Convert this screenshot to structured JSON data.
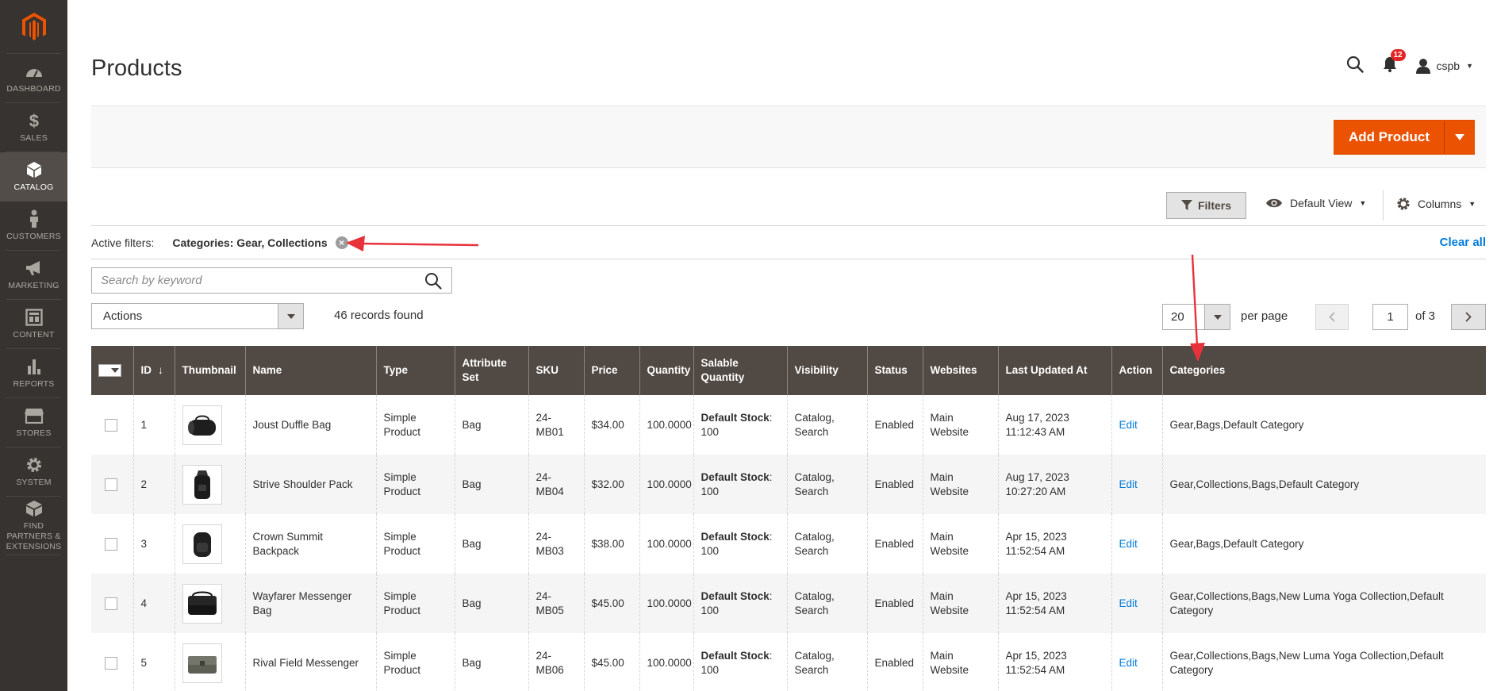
{
  "sidebar": {
    "items": [
      {
        "label": "DASHBOARD",
        "icon": "dashboard-icon"
      },
      {
        "label": "SALES",
        "icon": "dollar-icon"
      },
      {
        "label": "CATALOG",
        "icon": "cube-icon",
        "active": true
      },
      {
        "label": "CUSTOMERS",
        "icon": "person-icon"
      },
      {
        "label": "MARKETING",
        "icon": "megaphone-icon"
      },
      {
        "label": "CONTENT",
        "icon": "layout-icon"
      },
      {
        "label": "REPORTS",
        "icon": "bar-chart-icon"
      },
      {
        "label": "STORES",
        "icon": "store-icon"
      },
      {
        "label": "SYSTEM",
        "icon": "gear-icon"
      },
      {
        "label": "FIND PARTNERS & EXTENSIONS",
        "icon": "partners-icon"
      }
    ]
  },
  "header": {
    "title": "Products",
    "notifications_count": "12",
    "username": "cspb"
  },
  "action_bar": {
    "add_product_label": "Add Product"
  },
  "toolbar": {
    "filters_label": "Filters",
    "view_label": "Default View",
    "columns_label": "Columns"
  },
  "active_filters": {
    "label": "Active filters:",
    "chip": "Categories: Gear, Collections",
    "clear_all": "Clear all"
  },
  "search": {
    "placeholder": "Search by keyword"
  },
  "actions": {
    "label": "Actions",
    "records_found": "46 records found"
  },
  "pagination": {
    "per_page_value": "20",
    "per_page_label": "per page",
    "current_page": "1",
    "of_label": "of 3"
  },
  "table": {
    "columns": [
      "ID",
      "Thumbnail",
      "Name",
      "Type",
      "Attribute Set",
      "SKU",
      "Price",
      "Quantity",
      "Salable Quantity",
      "Visibility",
      "Status",
      "Websites",
      "Last Updated At",
      "Action",
      "Categories"
    ],
    "rows": [
      {
        "id": "1",
        "name": "Joust Duffle Bag",
        "type": "Simple Product",
        "attribute_set": "Bag",
        "sku": "24-MB01",
        "price": "$34.00",
        "quantity": "100.0000",
        "stock_label": "Default Stock",
        "stock_value": "100",
        "visibility": "Catalog, Search",
        "status": "Enabled",
        "websites": "Main Website",
        "updated_date": "Aug 17, 2023",
        "updated_time": "11:12:43 AM",
        "action": "Edit",
        "categories": "Gear,Bags,Default Category",
        "thumb": "duffle"
      },
      {
        "id": "2",
        "name": "Strive Shoulder Pack",
        "type": "Simple Product",
        "attribute_set": "Bag",
        "sku": "24-MB04",
        "price": "$32.00",
        "quantity": "100.0000",
        "stock_label": "Default Stock",
        "stock_value": "100",
        "visibility": "Catalog, Search",
        "status": "Enabled",
        "websites": "Main Website",
        "updated_date": "Aug 17, 2023",
        "updated_time": "10:27:20 AM",
        "action": "Edit",
        "categories": "Gear,Collections,Bags,Default Category",
        "thumb": "shoulder"
      },
      {
        "id": "3",
        "name": "Crown Summit Backpack",
        "type": "Simple Product",
        "attribute_set": "Bag",
        "sku": "24-MB03",
        "price": "$38.00",
        "quantity": "100.0000",
        "stock_label": "Default Stock",
        "stock_value": "100",
        "visibility": "Catalog, Search",
        "status": "Enabled",
        "websites": "Main Website",
        "updated_date": "Apr 15, 2023",
        "updated_time": "11:52:54 AM",
        "action": "Edit",
        "categories": "Gear,Bags,Default Category",
        "thumb": "backpack"
      },
      {
        "id": "4",
        "name": "Wayfarer Messenger Bag",
        "type": "Simple Product",
        "attribute_set": "Bag",
        "sku": "24-MB05",
        "price": "$45.00",
        "quantity": "100.0000",
        "stock_label": "Default Stock",
        "stock_value": "100",
        "visibility": "Catalog, Search",
        "status": "Enabled",
        "websites": "Main Website",
        "updated_date": "Apr 15, 2023",
        "updated_time": "11:52:54 AM",
        "action": "Edit",
        "categories": "Gear,Collections,Bags,New Luma Yoga Collection,Default Category",
        "thumb": "messenger"
      },
      {
        "id": "5",
        "name": "Rival Field Messenger",
        "type": "Simple Product",
        "attribute_set": "Bag",
        "sku": "24-MB06",
        "price": "$45.00",
        "quantity": "100.0000",
        "stock_label": "Default Stock",
        "stock_value": "100",
        "visibility": "Catalog, Search",
        "status": "Enabled",
        "websites": "Main Website",
        "updated_date": "Apr 15, 2023",
        "updated_time": "11:52:54 AM",
        "action": "Edit",
        "categories": "Gear,Collections,Bags,New Luma Yoga Collection,Default Category",
        "thumb": "field"
      }
    ]
  },
  "colors": {
    "sidebar_bg": "#373330",
    "accent_orange": "#eb5202",
    "table_header": "#514943",
    "link_blue": "#007bdb",
    "annotation_red": "#e8323b"
  }
}
